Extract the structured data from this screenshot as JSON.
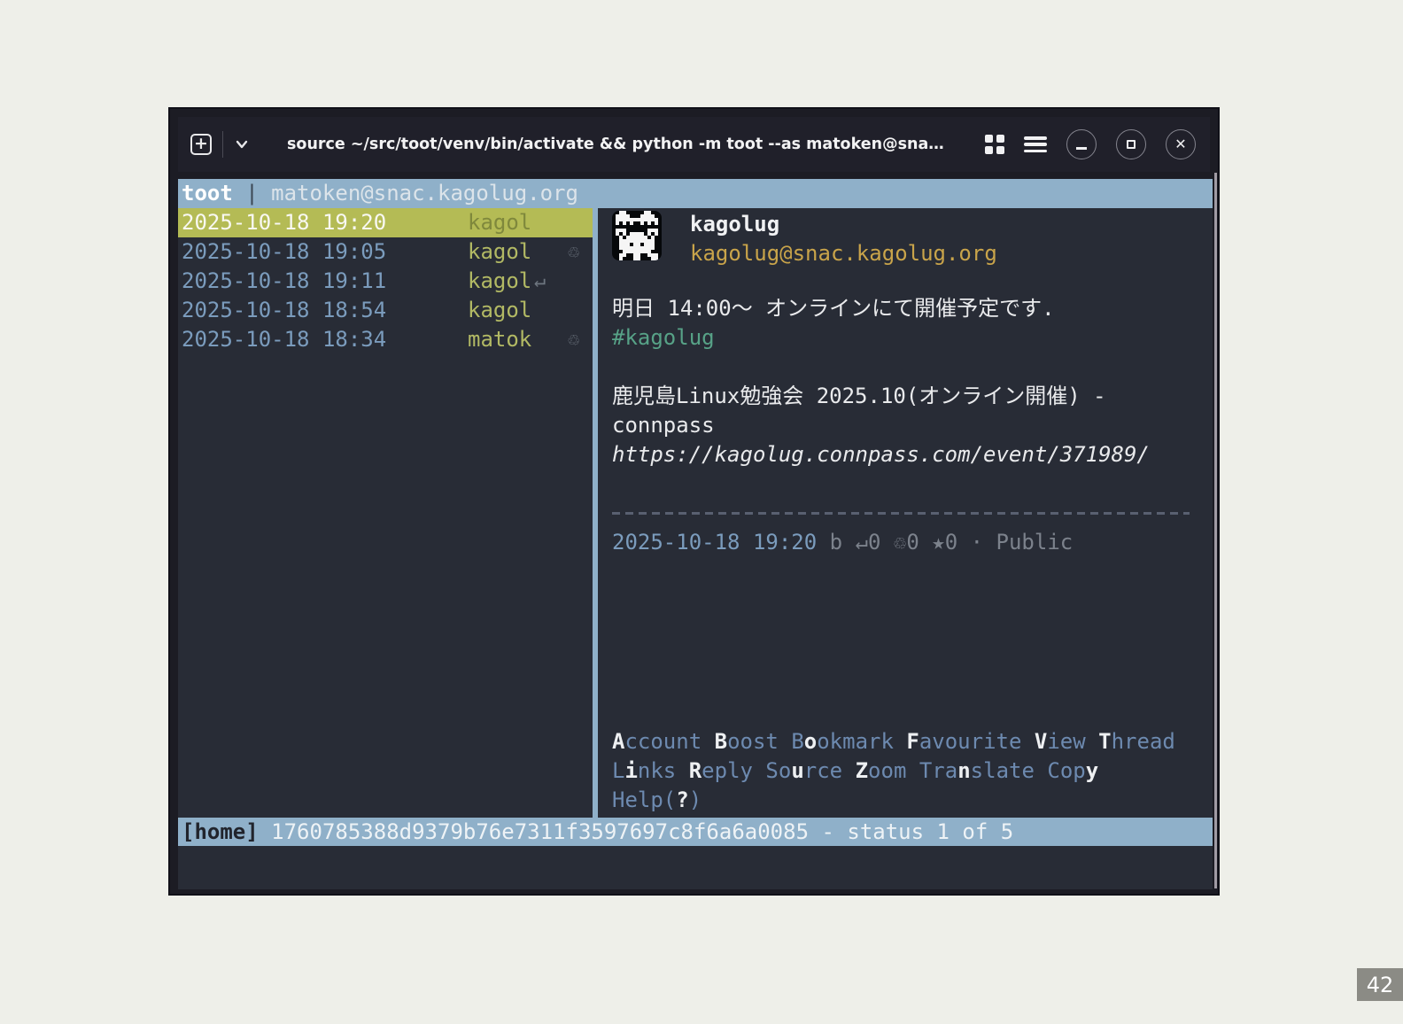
{
  "page": {
    "number": "42"
  },
  "colors": {
    "terminal_bg": "#282c36",
    "titlebar_bg": "#20202a",
    "bar_blue": "#8fb0c9",
    "selection_green": "#b4bb55",
    "date_blue": "#7b9cbd",
    "user_olive": "#b2b964",
    "handle_yellow": "#c9a44a",
    "hashtag_teal": "#57a287",
    "menu_blue": "#6d8ab0",
    "page_badge_gray": "#8b8b85"
  },
  "window": {
    "titlebar": {
      "title": "source ~/src/toot/venv/bin/activate && python -m toot --as matoken@sna…",
      "new_tab_label": "+"
    },
    "topbar": {
      "app": "toot",
      "separator": " | ",
      "account": "matoken@snac.kagolug.org"
    },
    "icons": {
      "boost": "♲",
      "reply": "↵"
    },
    "timeline": [
      {
        "date": "2025-10-18 19:20",
        "user": "kagol",
        "icon": "",
        "selected": true
      },
      {
        "date": "2025-10-18 19:05",
        "user": "kagol",
        "icon": "boost",
        "selected": false
      },
      {
        "date": "2025-10-18 19:11",
        "user": "kagol",
        "icon": "reply",
        "selected": false
      },
      {
        "date": "2025-10-18 18:54",
        "user": "kagol",
        "icon": "",
        "selected": false
      },
      {
        "date": "2025-10-18 18:34",
        "user": "matok",
        "icon": "boost",
        "selected": false
      }
    ],
    "detail": {
      "display_name": "kagolug",
      "handle": "kagolug@snac.kagolug.org",
      "content_lines": [
        {
          "text": "明日 14:00〜 オンラインにて開催予定です.",
          "style": "white"
        },
        {
          "text": "#kagolug",
          "style": "hashtag"
        },
        {
          "text": "",
          "style": "white"
        },
        {
          "text": "鹿児島Linux勉強会 2025.10(オンライン開催) -",
          "style": "white"
        },
        {
          "text": "connpass",
          "style": "white"
        },
        {
          "text": "https://kagolug.connpass.com/event/371989/",
          "style": "url"
        },
        {
          "text": "",
          "style": "white"
        },
        {
          "text": "",
          "style": "dash"
        }
      ],
      "meta": {
        "timestamp": "2025-10-18 19:20",
        "flag": "b",
        "replies": "↵0",
        "boosts": "♲0",
        "favourites": "★0",
        "dot": "·",
        "scope": "Public"
      },
      "avatar_pixels": [
        "..##.....##...",
        ".####...####..",
        ".############.",
        ".#.#.#..#.#.#.",
        "..............",
        ".###......###.",
        ".#.#.####.#.#.",
        "..#.######.#..",
        "..##########..",
        "..###.##.###..",
        "..##########..",
        "...########...",
        "..##..##..###.",
        "..#...##...##."
      ]
    },
    "menu": {
      "rows": [
        [
          {
            "t": "Account",
            "h": 0
          },
          {
            "t": "Boost",
            "h": 0
          },
          {
            "t": "Bookmark",
            "h": 1
          },
          {
            "t": "Favourite",
            "h": 0
          },
          {
            "t": "View",
            "h": 0
          },
          {
            "t": "Thread",
            "h": 0
          }
        ],
        [
          {
            "t": "Links",
            "h": 1
          },
          {
            "t": "Reply",
            "h": 0
          },
          {
            "t": "Source",
            "h": 2
          },
          {
            "t": "Zoom",
            "h": 0
          },
          {
            "t": "Translate",
            "h": 3
          },
          {
            "t": "Copy",
            "h": 3
          }
        ],
        [
          {
            "t": "Help(?)",
            "h": 5
          }
        ]
      ]
    },
    "statusbar": {
      "context": "[home]",
      "status_id": "1760785388d9379b76e7311f3597697c8f6a6a0085",
      "position": "- status 1 of 5"
    }
  }
}
